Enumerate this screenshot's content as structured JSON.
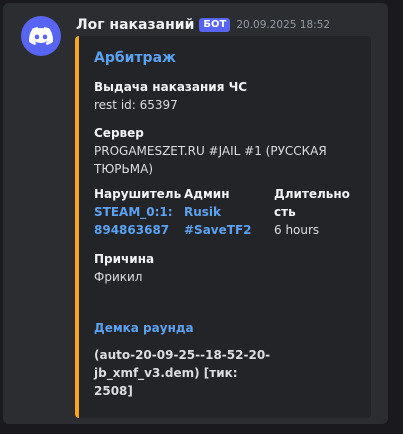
{
  "message": {
    "username": "Лог наказаний",
    "badge": "БОТ",
    "timestamp": "20.09.2025 18:52",
    "avatar_icon": "discord-logo-icon",
    "avatar_color": "#5865f2"
  },
  "embed": {
    "accent_color": "#f5a623",
    "title": "Арбитраж",
    "punishment": {
      "label": "Выдача наказания ЧС",
      "value": "rest id: 65397"
    },
    "server": {
      "label": "Сервер",
      "value": "PROGAMESZET.RU #JAIL #1 (РУССКАЯ ТЮРЬМА)"
    },
    "violator": {
      "label": "Нарушитель",
      "value": "STEAM_0:1: 894863687"
    },
    "admin": {
      "label": "Админ",
      "name": "Rusik",
      "tag": "#SaveTF2"
    },
    "duration": {
      "label": "Длительность",
      "value": "6 hours"
    },
    "reason": {
      "label": "Причина",
      "value": "Фрикил"
    },
    "demo": {
      "label": "Демка раунда",
      "value": "(auto-20-09-25--18-52-20-jb_xmf_v3.dem) [тик: 2508]"
    }
  }
}
